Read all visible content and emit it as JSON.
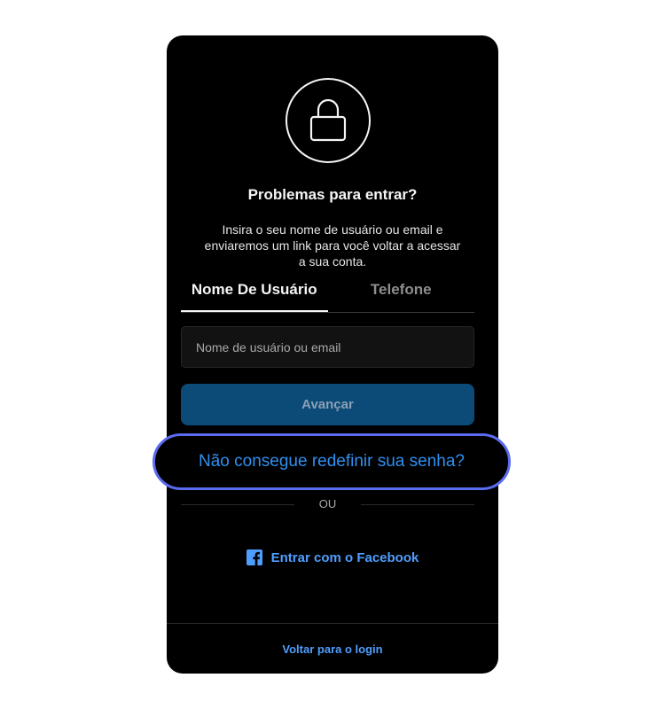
{
  "header": {
    "title": "Problemas para entrar?",
    "description": "Insira o seu nome de usuário ou email e enviaremos um link para você voltar a acessar a sua conta."
  },
  "tabs": [
    {
      "label": "Nome De Usuário",
      "active": true
    },
    {
      "label": "Telefone",
      "active": false
    }
  ],
  "form": {
    "username_placeholder": "Nome de usuário ou email",
    "username_value": "",
    "submit_label": "Avançar"
  },
  "reset_link": "Não consegue redefinir sua senha?",
  "divider_label": "OU",
  "facebook": {
    "label": "Entrar com o Facebook",
    "icon": "facebook-icon"
  },
  "footer": {
    "back_label": "Voltar para o login"
  },
  "colors": {
    "background": "#000000",
    "accent_blue": "#4f9eff",
    "button_blue": "#0c4a77",
    "highlight_border": "#5b6cf0"
  }
}
